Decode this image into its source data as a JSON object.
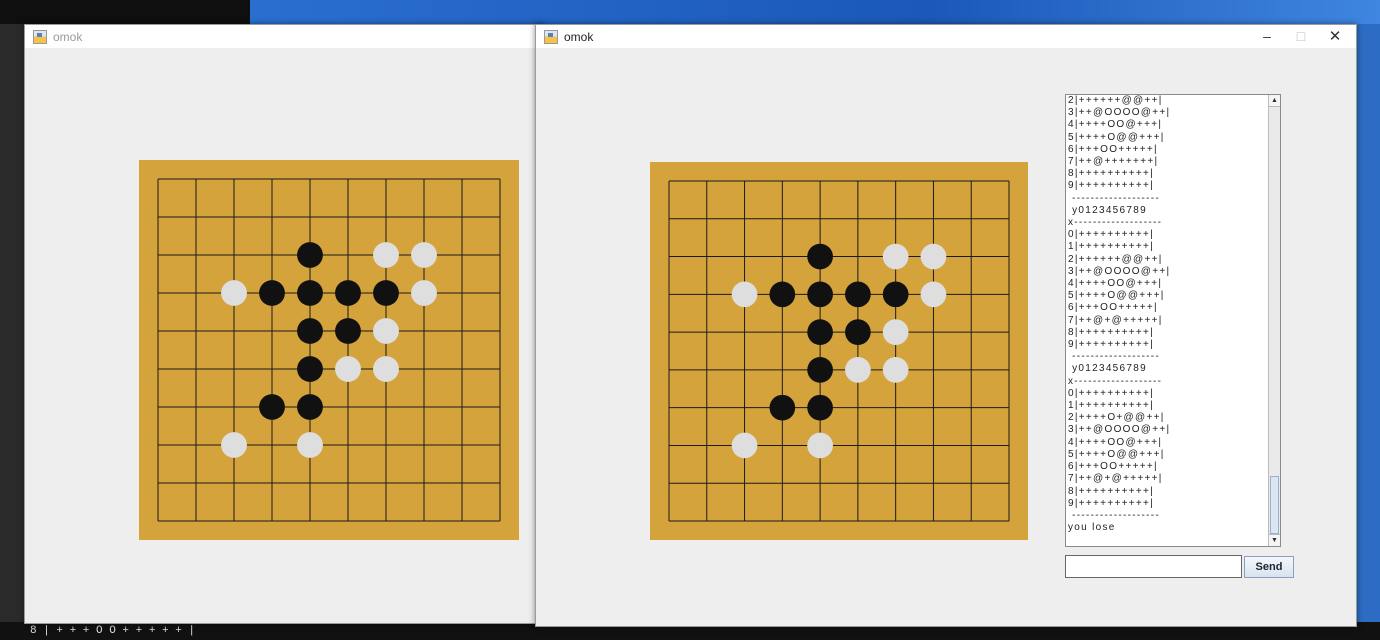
{
  "desktop": {
    "bottom_text": "8 | + + + O O + + + + + |"
  },
  "window_left": {
    "title": "omok"
  },
  "window_right": {
    "title": "omok",
    "controls": {
      "minimize": "–",
      "maximize": "□",
      "close": "✕"
    },
    "log_lines": [
      "2|++++++@@++|",
      "3|++@OOOO@++|",
      "4|++++OO@+++|",
      "5|++++O@@+++|",
      "6|+++OO+++++|",
      "7|++@+++++++|",
      "8|++++++++++|",
      "9|++++++++++|",
      " -------------------",
      " y0123456789",
      "x-------------------",
      "0|++++++++++|",
      "1|++++++++++|",
      "2|++++++@@++|",
      "3|++@OOOO@++|",
      "4|++++OO@+++|",
      "5|++++O@@+++|",
      "6|+++OO+++++|",
      "7|++@+@+++++|",
      "8|++++++++++|",
      "9|++++++++++|",
      " -------------------",
      " y0123456789",
      "x-------------------",
      "0|++++++++++|",
      "1|++++++++++|",
      "2|++++O+@@++|",
      "3|++@OOOO@++|",
      "4|++++OO@+++|",
      "5|++++O@@+++|",
      "6|+++OO+++++|",
      "7|++@+@+++++|",
      "8|++++++++++|",
      "9|++++++++++|",
      " -------------------",
      "you lose"
    ],
    "scroll_up": "▲",
    "scroll_down": "▼",
    "input_value": "",
    "send_label": "Send"
  },
  "board": {
    "size": 10,
    "colors": {
      "wood": "#d5a33b",
      "black": "#111111",
      "white": "#dedede"
    },
    "stones": [
      {
        "col": 4,
        "row": 2,
        "color": "black"
      },
      {
        "col": 6,
        "row": 2,
        "color": "white"
      },
      {
        "col": 7,
        "row": 2,
        "color": "white"
      },
      {
        "col": 2,
        "row": 3,
        "color": "white"
      },
      {
        "col": 3,
        "row": 3,
        "color": "black"
      },
      {
        "col": 4,
        "row": 3,
        "color": "black"
      },
      {
        "col": 5,
        "row": 3,
        "color": "black"
      },
      {
        "col": 6,
        "row": 3,
        "color": "black"
      },
      {
        "col": 7,
        "row": 3,
        "color": "white"
      },
      {
        "col": 4,
        "row": 4,
        "color": "black"
      },
      {
        "col": 5,
        "row": 4,
        "color": "black"
      },
      {
        "col": 6,
        "row": 4,
        "color": "white"
      },
      {
        "col": 4,
        "row": 5,
        "color": "black"
      },
      {
        "col": 5,
        "row": 5,
        "color": "white"
      },
      {
        "col": 6,
        "row": 5,
        "color": "white"
      },
      {
        "col": 3,
        "row": 6,
        "color": "black"
      },
      {
        "col": 4,
        "row": 6,
        "color": "black"
      },
      {
        "col": 2,
        "row": 7,
        "color": "white"
      },
      {
        "col": 4,
        "row": 7,
        "color": "white"
      }
    ]
  }
}
